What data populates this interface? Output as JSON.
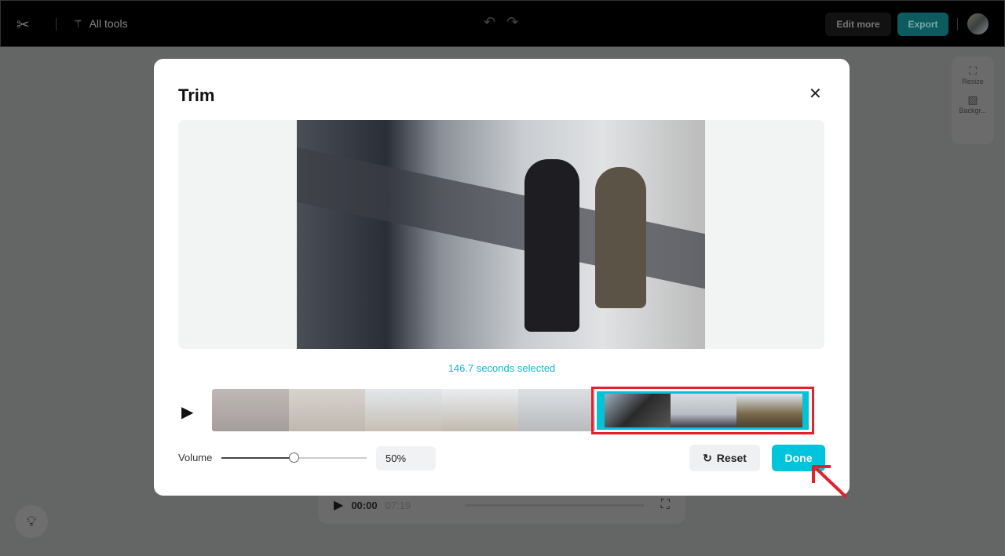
{
  "topbar": {
    "all_tools": "All tools",
    "edit_more": "Edit more",
    "export": "Export"
  },
  "side_panel": {
    "resize": "Resize",
    "background": "Backgr..."
  },
  "player": {
    "current_time": "00:00",
    "duration": "07:19"
  },
  "modal": {
    "title": "Trim",
    "selected_text": "146.7 seconds selected",
    "volume_label": "Volume",
    "volume_value": "50%",
    "volume_level": 0.5,
    "reset_label": "Reset",
    "done_label": "Done"
  },
  "colors": {
    "accent": "#00c3dc",
    "highlight": "#e3202c"
  }
}
